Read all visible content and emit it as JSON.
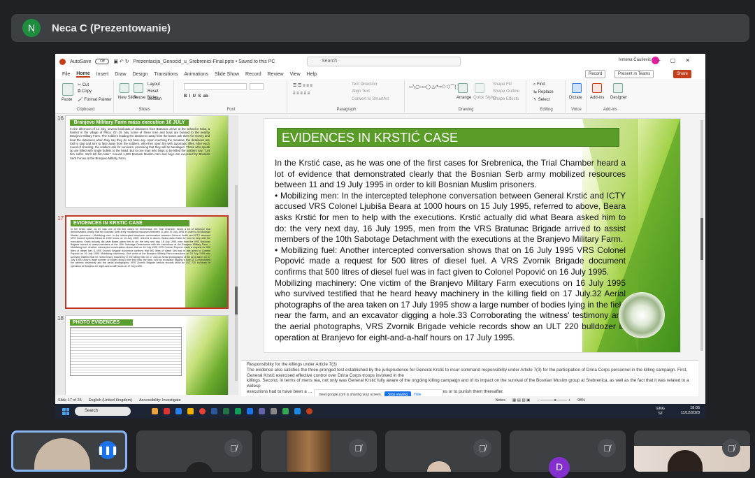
{
  "meet": {
    "presenter_initial": "N",
    "presenter_label": "Neca C (Prezentowanie)"
  },
  "ppt": {
    "autosave": "AutoSave",
    "autosave_state": "Off",
    "filename": "Prezentacija_Genocid_u_Srebrenici-Final.pptx • Saved to this PC",
    "search_placeholder": "Search",
    "user": "Ivmena Čaušević",
    "menu": [
      "File",
      "Home",
      "Insert",
      "Draw",
      "Design",
      "Transitions",
      "Animations",
      "Slide Show",
      "Record",
      "Review",
      "View",
      "Help"
    ],
    "record_btn": "Record",
    "present_teams_btn": "Present in Teams",
    "share_btn": "Share",
    "ribbon": {
      "clipboard": {
        "paste": "Paste",
        "cut": "Cut",
        "copy": "Copy",
        "format_painter": "Format Painter",
        "label": "Clipboard"
      },
      "slides": {
        "new_slide": "New Slide",
        "reuse_slides": "Reuse Slides",
        "layout": "Layout",
        "reset": "Reset",
        "section": "Section",
        "label": "Slides"
      },
      "font": {
        "label": "Font"
      },
      "paragraph": {
        "text_direction": "Text Direction",
        "align_text": "Align Text",
        "smartart": "Convert to SmartArt",
        "label": "Paragraph"
      },
      "drawing": {
        "arrange": "Arrange",
        "quick_styles": "Quick Styles",
        "shape_fill": "Shape Fill",
        "shape_outline": "Shape Outline",
        "shape_effects": "Shape Effects",
        "label": "Drawing"
      },
      "editing": {
        "find": "Find",
        "replace": "Replace",
        "select": "Select",
        "label": "Editing"
      },
      "voice": {
        "dictate": "Dictate",
        "label": "Voice"
      },
      "addins": {
        "addins": "Add-ins",
        "designer": "Designer",
        "label": "Add-ins"
      }
    },
    "thumbs": [
      {
        "num": "16",
        "title": "Branjevo Military Farm mass execution 16 JULY",
        "text": "In the afternoon of 14 July, several busloads of detainees from Bratunac arrive at the school in Kula, a hamlet in the village of Pilica. On 16 July, some of these men and boys are bussed to the nearby Branjevo Military Farm. The soldiers leading the detainees away from the buses ask them for money and beat the detainees when they say they do not have any. Upon reaching the meadow, the detainees are told to stop and turn to face away from the soldiers, who then open fire with automatic rifles. After each round of shooting, the soldiers ask for survivors, promising that they will be bandaged. Those who speak up are killed with single bullets to the head. But to one man who begs to be killed the soldiers say: \"Let him suffer. We'll kill him later.\" Around 1,200 Bosnian Muslim men and boys are executed by Bosnian Serb Forces at the Branjevo Military Farm."
      },
      {
        "num": "17",
        "title": "EVIDENCES IN KRSTIĆ CASE",
        "text": "In the Krstić case, as he was one of the first cases for Srebrenica, the Trial Chamber heard a lot of evidence that demonstrated clearly that the Bosnian Serb army mobilized resources between 11 and 19 July 1995 in order to kill Bosnian Muslim prisoners. • Mobilizing men: In the intercepted telephone conversation between General Krstić and ICTY accused VRS Colonel Ljubiša Beara at 1000 hours on 15 July 1995, referred to above, Beara asks Krstić for men to help with the executions. Krstić actually did what Beara asked him to do: the very next day, 16 July 1995, men from the VRS Bratunac Brigade arrived to assist members of the 10th Sabotage Detachment with the executions at the Branjevo Military Farm. • Mobilizing fuel: Another intercepted conversation shows that on 16 July 1995 VRS Colonel Popović made a request for 500 litres of diesel fuel. A VRS Zvornik Brigade document confirms that 500 litres of diesel fuel was in fact given to Colonel Popović on 16 July 1995. Mobilizing machinery: One victim of the Branjevo Military Farm executions on 16 July 1995 who survived testified that he heard heavy machinery in the killing field on 17 July.32 Aerial photographs of the area taken on 17 July 1995 show a large number of bodies lying in the field near the farm, and an excavator digging a hole.33 Corroborating the witness' testimony and the aerial photographs, VRS Zvornik Brigade vehicle records show an ULT 220 bulldozer in operation at Branjevo for eight-and-a-half hours on 17 July 1995."
      },
      {
        "num": "18",
        "title": "PHOTO EVIDENCES",
        "text": ""
      }
    ],
    "slide": {
      "title": "EVIDENCES IN KRSTIĆ CASE",
      "p1": "In the Krstić case, as he was one of the first cases for Srebrenica, the Trial Chamber heard a lot of evidence that demonstrated clearly that the Bosnian Serb army mobilized resources between 11 and 19 July 1995 in order to kill Bosnian Muslim prisoners.",
      "p2": "• Mobilizing men: In the intercepted telephone conversation between General Krstić and ICTY accused VRS Colonel Ljubiša Beara at 1000 hours on 15 July 1995, referred to above, Beara asks Krstić for men to help with the executions. Krstić actually did what Beara asked him to do: the very next day, 16 July 1995, men from the VRS Bratunac Brigade arrived to assist members of the 10th Sabotage Detachment with the executions at the Branjevo Military Farm.",
      "p3": "• Mobilizing fuel: Another intercepted conversation shows that on 16 July 1995 VRS Colonel Popović made a request for 500 litres of diesel fuel. A VRS Zvornik Brigade document confirms that 500 litres of diesel fuel was in fact given to Colonel Popović on 16 July 1995.",
      "p4": "Mobilizing machinery: One victim of the Branjevo Military Farm executions on 16 July 1995 who survived testified that he heard heavy machinery in the killing field on 17 July.32 Aerial photographs of the area taken on 17 July 1995 show a large number of bodies lying in the field near the farm, and an excavator digging a hole.33 Corroborating the witness' testimony and the aerial photographs, VRS Zvornik Brigade vehicle records show an ULT 220 bulldozer in operation at Branjevo for eight-and-a-half hours on 17 July 1995."
    },
    "notes": [
      "Responsibility for the killings under Article 7(3)",
      "The evidence also satisfies the three-pronged test established by the jurisprudence for General Krstić to incur command responsibility under Article 7(3) for the participation of Drina Corps personnel in the killing campaign. First, General Krstić exercised effective control over Drina Corps troops involved in the",
      "killings. Second, in terms of mens rea, not only was General Krstić fully aware of the ongoing killing campaign and of its impact on the survival of the Bosnian Muslim group at Srebrenica, as well as the fact that it was related to a widesp",
      "executions had to have been a"
    ],
    "notes_tail1": "civilian population, but the Drina Corps (and Main Staff) officers and troops involved in conducting the",
    "notes_tail2": "prevent his Drina Corps subordinates from participating in the crimes or to punish them thereafter.",
    "share_banner": {
      "text": "meet.google.com is sharing your screen.",
      "stop": "Stop sharing",
      "hide": "Hide"
    },
    "status": {
      "slide": "Slide 17 of 25",
      "lang": "English (United Kingdom)",
      "access": "Accessibility: Investigate",
      "notes": "Notes",
      "zoom": "98%"
    },
    "taskbar": {
      "search": "Search",
      "lang": "ENG",
      "region": "ST",
      "time": "18:05",
      "date": "11/12/2023"
    }
  },
  "participants": [
    {
      "name": "participant-1",
      "speaking": true
    },
    {
      "name": "participant-2",
      "muted": true
    },
    {
      "name": "participant-3",
      "muted": true
    },
    {
      "name": "participant-4",
      "muted": true
    },
    {
      "name": "participant-5",
      "initial": "D",
      "muted": true
    },
    {
      "name": "participant-6",
      "muted": true
    }
  ],
  "colors": {
    "meet_bg": "#202124",
    "tile_bg": "#3c4043",
    "slide_green": "#5a9c28",
    "accent_red": "#c43e1c",
    "meet_blue": "#1a73e8"
  }
}
